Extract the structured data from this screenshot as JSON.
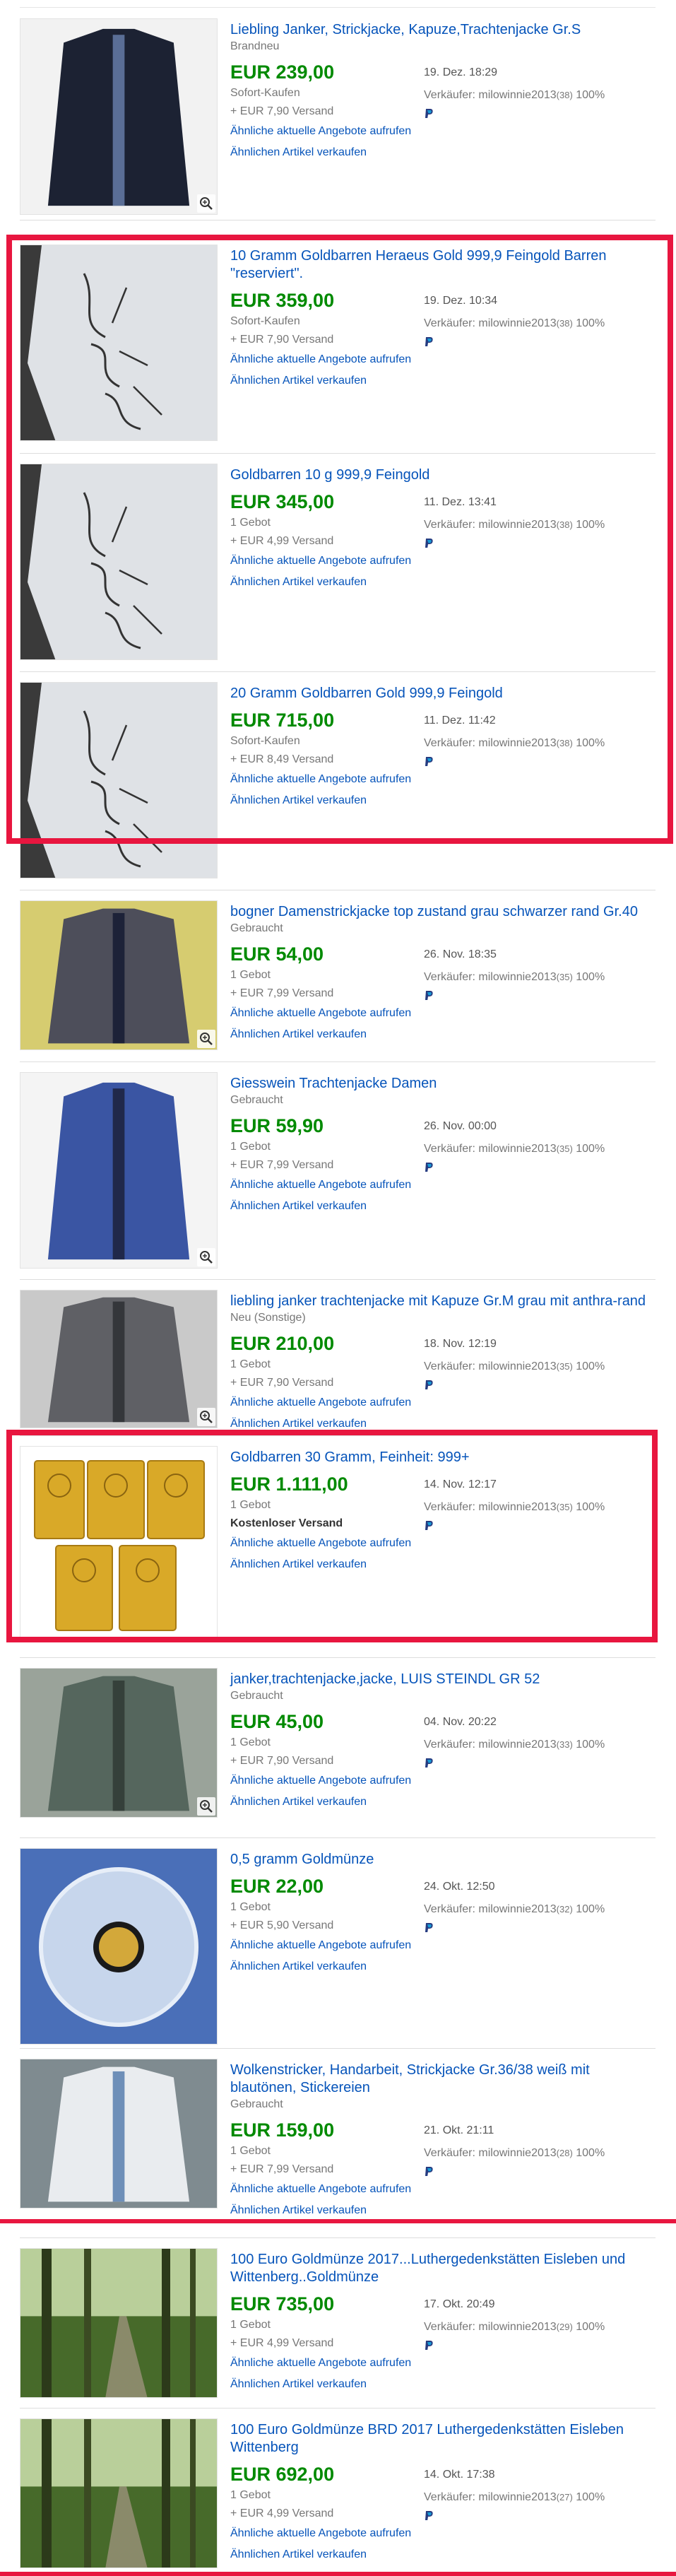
{
  "listings": [
    {
      "title": "Liebling Janker, Strickjacke, Kapuze,Trachtenjacke Gr.S",
      "condition": "Brandneu",
      "price": "EUR 239,00",
      "format": "Sofort-Kaufen",
      "shipping": "+ EUR 7,90 Versand",
      "similar_link": "Ähnliche aktuelle Angebote aufrufen",
      "sell_link": "Ähnlichen Artikel verkaufen",
      "date": "19. Dez. 18:29",
      "seller": "Verkäufer: milowinnie2013",
      "feedback": "(38)",
      "rating": "100%",
      "image": "navy-hooded-cardigan",
      "zoom": true
    },
    {
      "title": "10 Gramm Goldbarren Heraeus Gold 999,9 Feingold Barren \"reserviert\".",
      "condition": "",
      "price": "EUR 359,00",
      "format": "Sofort-Kaufen",
      "shipping": "+ EUR 7,90 Versand",
      "similar_link": "Ähnliche aktuelle Angebote aufrufen",
      "sell_link": "Ähnlichen Artikel verkaufen",
      "date": "19. Dez. 10:34",
      "seller": "Verkäufer: milowinnie2013",
      "feedback": "(38)",
      "rating": "100%",
      "image": "paper-handwritten-kommt",
      "zoom": false
    },
    {
      "title": "Goldbarren 10 g  999,9 Feingold",
      "condition": "",
      "price": "EUR 345,00",
      "format": "1 Gebot",
      "shipping": "+ EUR 4,99 Versand",
      "similar_link": "Ähnliche aktuelle Angebote aufrufen",
      "sell_link": "Ähnlichen Artikel verkaufen",
      "date": "11. Dez. 13:41",
      "seller": "Verkäufer: milowinnie2013",
      "feedback": "(38)",
      "rating": "100%",
      "image": "paper-handwritten-kommt",
      "zoom": false
    },
    {
      "title": "20 Gramm Goldbarren  Gold 999,9 Feingold",
      "condition": "",
      "price": "EUR 715,00",
      "format": "Sofort-Kaufen",
      "shipping": "+ EUR 8,49 Versand",
      "similar_link": "Ähnliche aktuelle Angebote aufrufen",
      "sell_link": "Ähnlichen Artikel verkaufen",
      "date": "11. Dez. 11:42",
      "seller": "Verkäufer: milowinnie2013",
      "feedback": "(38)",
      "rating": "100%",
      "image": "paper-handwritten-kommt",
      "zoom": false
    },
    {
      "title": "bogner Damenstrickjacke top zustand grau schwarzer rand Gr.40",
      "condition": "Gebraucht",
      "price": "EUR 54,00",
      "format": "1 Gebot",
      "shipping": "+ EUR 7,99 Versand",
      "similar_link": "Ähnliche aktuelle Angebote aufrufen",
      "sell_link": "Ähnlichen Artikel verkaufen",
      "date": "26. Nov. 18:35",
      "seller": "Verkäufer: milowinnie2013",
      "feedback": "(35)",
      "rating": "100%",
      "image": "grey-cardigan",
      "zoom": true
    },
    {
      "title": "Giesswein Trachtenjacke Damen",
      "condition": "Gebraucht",
      "price": "EUR 59,90",
      "format": "1 Gebot",
      "shipping": "+ EUR 7,99 Versand",
      "similar_link": "Ähnliche aktuelle Angebote aufrufen",
      "sell_link": "Ähnlichen Artikel verkaufen",
      "date": "26. Nov. 00:00",
      "seller": "Verkäufer: milowinnie2013",
      "feedback": "(35)",
      "rating": "100%",
      "image": "blue-jacket",
      "zoom": true
    },
    {
      "title": "liebling janker trachtenjacke mit Kapuze Gr.M grau mit anthra-rand",
      "condition": "Neu (Sonstige)",
      "price": "EUR 210,00",
      "format": "1 Gebot",
      "shipping": "+ EUR 7,90 Versand",
      "similar_link": "Ähnliche aktuelle Angebote aufrufen",
      "sell_link": "Ähnlichen Artikel verkaufen",
      "date": "18. Nov. 12:19",
      "seller": "Verkäufer: milowinnie2013",
      "feedback": "(35)",
      "rating": "100%",
      "image": "grey-knit-hood",
      "zoom": true
    },
    {
      "title": "Goldbarren 30  Gramm, Feinheit: 999+",
      "condition": "",
      "price": "EUR 1.111,00",
      "format": "1 Gebot",
      "shipping": "Kostenloser Versand",
      "free_shipping": true,
      "similar_link": "Ähnliche aktuelle Angebote aufrufen",
      "sell_link": "Ähnlichen Artikel verkaufen",
      "date": "14. Nov. 12:17",
      "seller": "Verkäufer: milowinnie2013",
      "feedback": "(35)",
      "rating": "100%",
      "image": "gold-bars",
      "zoom": false
    },
    {
      "title": "janker,trachtenjacke,jacke, LUIS STEINDL GR 52",
      "condition": "Gebraucht",
      "price": "EUR 45,00",
      "format": "1 Gebot",
      "shipping": "+ EUR 7,90 Versand",
      "similar_link": "Ähnliche aktuelle Angebote aufrufen",
      "sell_link": "Ähnlichen Artikel verkaufen",
      "date": "04. Nov. 20:22",
      "seller": "Verkäufer: milowinnie2013",
      "feedback": "(33)",
      "rating": "100%",
      "image": "green-knit",
      "zoom": true
    },
    {
      "title": "0,5 gramm Goldmünze",
      "condition": "",
      "price": "EUR 22,00",
      "format": "1 Gebot",
      "shipping": "+ EUR 5,90 Versand",
      "similar_link": "Ähnliche aktuelle Angebote aufrufen",
      "sell_link": "Ähnlichen Artikel verkaufen",
      "date": "24. Okt. 12:50",
      "seller": "Verkäufer: milowinnie2013",
      "feedback": "(32)",
      "rating": "100%",
      "image": "gold-coin-capsule",
      "zoom": false
    },
    {
      "title": "Wolkenstricker, Handarbeit, Strickjacke Gr.36/38 weiß mit blautönen, Stickereien",
      "condition": "Gebraucht",
      "price": "EUR 159,00",
      "format": "1 Gebot",
      "shipping": "+ EUR 7,99 Versand",
      "similar_link": "Ähnliche aktuelle Angebote aufrufen",
      "sell_link": "Ähnlichen Artikel verkaufen",
      "date": "21. Okt. 21:11",
      "seller": "Verkäufer: milowinnie2013",
      "feedback": "(28)",
      "rating": "100%",
      "image": "white-blue-knit",
      "zoom": false
    },
    {
      "title": "100 Euro Goldmünze 2017...Luthergedenkstätten Eisleben und Wittenberg..Goldmünze",
      "condition": "",
      "price": "EUR 735,00",
      "format": "1 Gebot",
      "shipping": "+ EUR 4,99 Versand",
      "similar_link": "Ähnliche aktuelle Angebote aufrufen",
      "sell_link": "Ähnlichen Artikel verkaufen",
      "date": "17. Okt. 20:49",
      "seller": "Verkäufer: milowinnie2013",
      "feedback": "(29)",
      "rating": "100%",
      "image": "forest-path",
      "zoom": false
    },
    {
      "title": "100 Euro Goldmünze BRD 2017 Luthergedenkstätten Eisleben Wittenberg",
      "condition": "",
      "price": "EUR 692,00",
      "format": "1 Gebot",
      "shipping": "+ EUR 4,99 Versand",
      "similar_link": "Ähnliche aktuelle Angebote aufrufen",
      "sell_link": "Ähnlichen Artikel verkaufen",
      "date": "14. Okt. 17:38",
      "seller": "Verkäufer: milowinnie2013",
      "feedback": "(27)",
      "rating": "100%",
      "image": "forest-path",
      "zoom": false
    }
  ],
  "annotation_color": "#e8163f",
  "price_color": "#008a00",
  "link_color": "#0654ba"
}
